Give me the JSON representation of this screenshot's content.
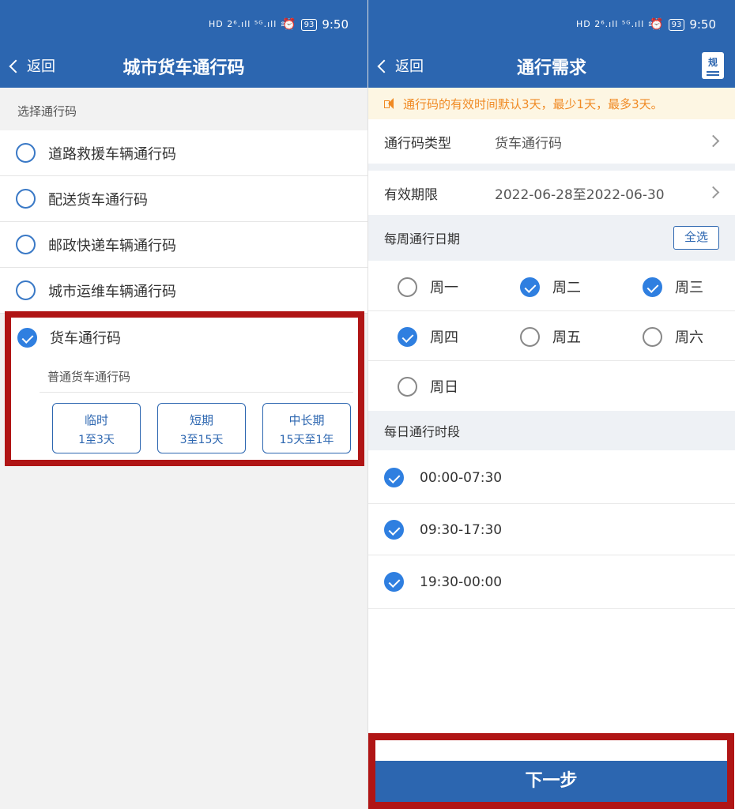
{
  "status": {
    "time": "9:50",
    "battery": "93",
    "icons_text": "HD 2⁶.ıll ⁵ᴳ.ıll ≋"
  },
  "left": {
    "back_label": "返回",
    "title": "城市货车通行码",
    "section_label": "选择通行码",
    "options": [
      {
        "label": "道路救援车辆通行码"
      },
      {
        "label": "配送货车通行码"
      },
      {
        "label": "邮政快递车辆通行码"
      },
      {
        "label": "城市运维车辆通行码"
      }
    ],
    "selected": {
      "label": "货车通行码",
      "sub": "普通货车通行码",
      "durations": [
        {
          "name": "临时",
          "range": "1至3天"
        },
        {
          "name": "短期",
          "range": "3至15天"
        },
        {
          "name": "中长期",
          "range": "15天至1年"
        }
      ]
    }
  },
  "right": {
    "back_label": "返回",
    "title": "通行需求",
    "doc_icon_label": "规",
    "notice": "通行码的有效时间默认3天，最少1天，最多3天。",
    "type_row": {
      "label": "通行码类型",
      "value": "货车通行码"
    },
    "period_row": {
      "label": "有效期限",
      "value": "2022-06-28至2022-06-30"
    },
    "week_label": "每周通行日期",
    "select_all": "全选",
    "days": [
      {
        "label": "周一",
        "checked": false
      },
      {
        "label": "周二",
        "checked": true
      },
      {
        "label": "周三",
        "checked": true
      },
      {
        "label": "周四",
        "checked": true
      },
      {
        "label": "周五",
        "checked": false
      },
      {
        "label": "周六",
        "checked": false
      },
      {
        "label": "周日",
        "checked": false
      }
    ],
    "time_label": "每日通行时段",
    "slots": [
      {
        "label": "00:00-07:30",
        "checked": true
      },
      {
        "label": "09:30-17:30",
        "checked": true
      },
      {
        "label": "19:30-00:00",
        "checked": true
      }
    ],
    "next_label": "下一步"
  },
  "colors": {
    "header_blue": "#2c66b0",
    "check_blue": "#2f7fe0",
    "highlight_red": "#b01515",
    "notice_orange": "#f08a24"
  }
}
